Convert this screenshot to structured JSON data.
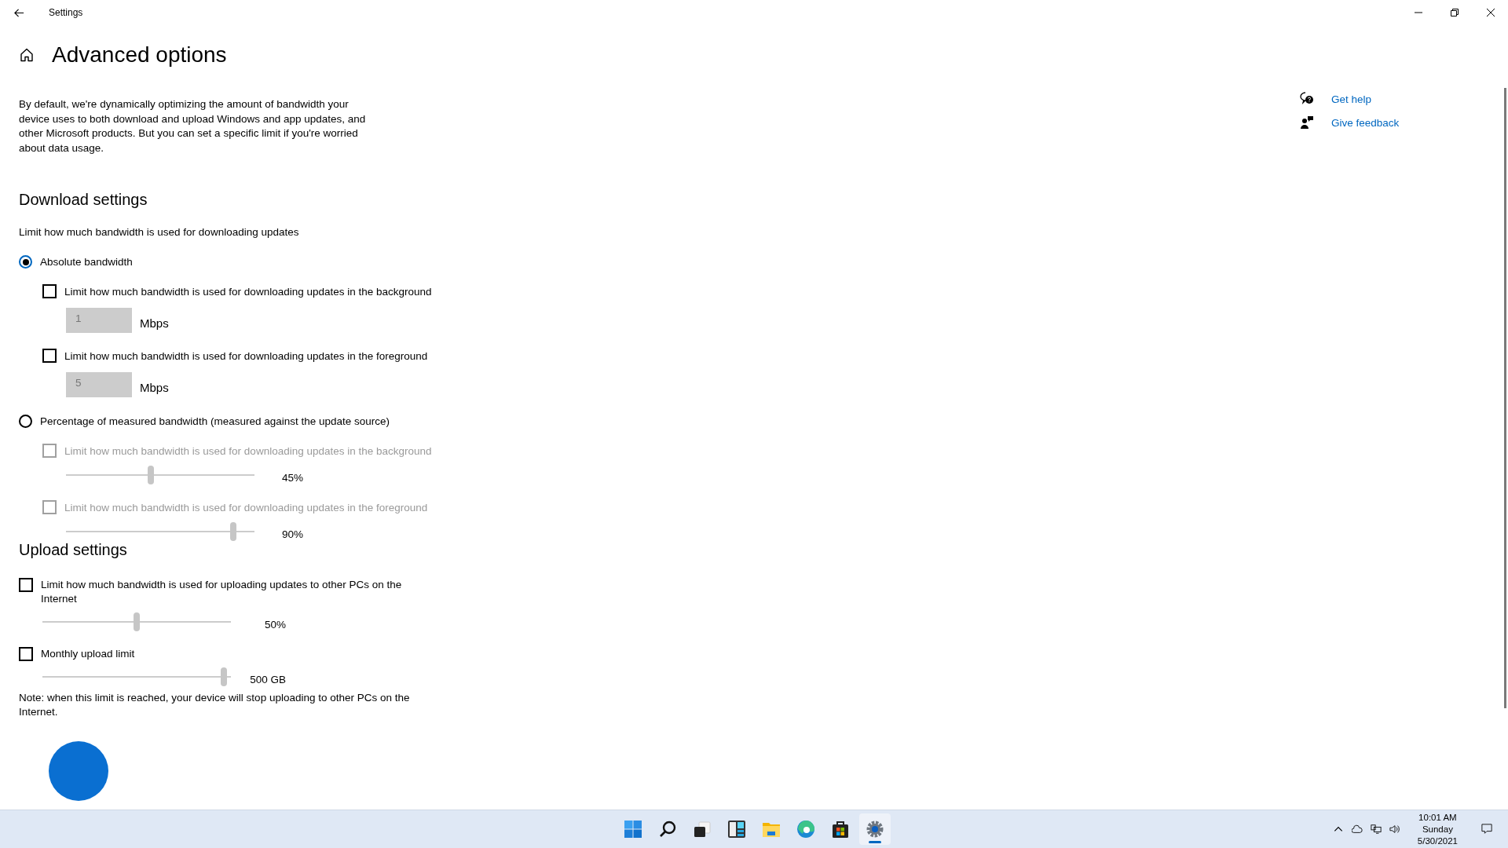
{
  "window": {
    "title": "Settings"
  },
  "page": {
    "title": "Advanced options",
    "description": "By default, we're dynamically optimizing the amount of bandwidth your device uses to both download and upload Windows and app updates, and other Microsoft products. But you can set a specific limit if you're worried about data usage."
  },
  "help_links": [
    {
      "kind": "help",
      "label": "Get help"
    },
    {
      "kind": "feedback",
      "label": "Give feedback"
    }
  ],
  "download": {
    "heading": "Download settings",
    "subtitle": "Limit how much bandwidth is used for downloading updates",
    "options": [
      {
        "label": "Absolute bandwidth",
        "selected": true,
        "settings": [
          {
            "kind": "input",
            "label": "Limit how much bandwidth is used for downloading updates in the background",
            "checked": false,
            "disabled": false,
            "value": "1",
            "unit": "Mbps"
          },
          {
            "kind": "input",
            "label": "Limit how much bandwidth is used for downloading updates in the foreground",
            "checked": false,
            "disabled": false,
            "value": "5",
            "unit": "Mbps"
          }
        ]
      },
      {
        "label": "Percentage of measured bandwidth (measured against the update source)",
        "selected": false,
        "settings": [
          {
            "kind": "slider",
            "label": "Limit how much bandwidth is used for downloading updates in the background",
            "checked": false,
            "disabled": true,
            "level": 0.45,
            "reading": "45%"
          },
          {
            "kind": "slider",
            "label": "Limit how much bandwidth is used for downloading updates in the foreground",
            "checked": false,
            "disabled": true,
            "level": 0.9,
            "reading": "90%"
          }
        ]
      }
    ]
  },
  "upload": {
    "heading": "Upload settings",
    "settings": [
      {
        "kind": "slider",
        "label": "Limit how much bandwidth is used for uploading updates to other PCs on the Internet",
        "checked": false,
        "disabled": false,
        "level": 0.5,
        "reading": "50%"
      },
      {
        "kind": "slider",
        "label": "Monthly upload limit",
        "checked": false,
        "disabled": false,
        "level": 0.98,
        "reading": "500 GB"
      }
    ],
    "note": "Note: when this limit is reached, your device will stop uploading to other PCs on the Internet."
  },
  "taskbar": {
    "apps": [
      {
        "kind": "start",
        "active": false
      },
      {
        "kind": "search",
        "active": false
      },
      {
        "kind": "taskview",
        "active": false
      },
      {
        "kind": "widgets",
        "active": false
      },
      {
        "kind": "explorer",
        "active": false
      },
      {
        "kind": "edge",
        "active": false
      },
      {
        "kind": "store",
        "active": false
      },
      {
        "kind": "settings",
        "active": true
      }
    ],
    "clock": {
      "time": "10:01 AM",
      "day": "Sunday",
      "date": "5/30/2021"
    }
  }
}
